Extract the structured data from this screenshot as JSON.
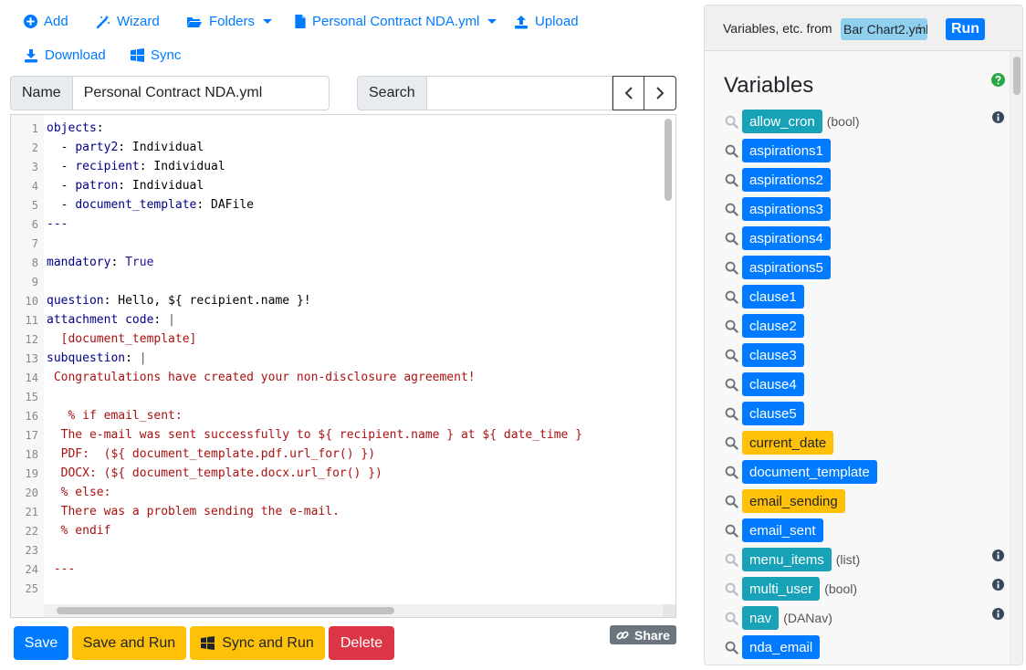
{
  "toolbar": {
    "add": "Add",
    "wizard": "Wizard",
    "folders": "Folders",
    "file_dropdown": "Personal Contract NDA.yml",
    "upload": "Upload",
    "download": "Download",
    "sync": "Sync"
  },
  "name_field": {
    "label": "Name",
    "value": "Personal Contract NDA.yml"
  },
  "search_field": {
    "label": "Search",
    "value": ""
  },
  "editor": {
    "lines": [
      {
        "n": "1",
        "parts": [
          {
            "c": "key",
            "t": "objects"
          },
          {
            "c": "val",
            "t": ":"
          }
        ]
      },
      {
        "n": "2",
        "parts": [
          {
            "c": "val",
            "t": "  - "
          },
          {
            "c": "key",
            "t": "party2"
          },
          {
            "c": "val",
            "t": ": Individual"
          }
        ]
      },
      {
        "n": "3",
        "parts": [
          {
            "c": "val",
            "t": "  - "
          },
          {
            "c": "key",
            "t": "recipient"
          },
          {
            "c": "val",
            "t": ": Individual"
          }
        ]
      },
      {
        "n": "4",
        "parts": [
          {
            "c": "val",
            "t": "  - "
          },
          {
            "c": "key",
            "t": "patron"
          },
          {
            "c": "val",
            "t": ": Individual"
          }
        ]
      },
      {
        "n": "5",
        "parts": [
          {
            "c": "val",
            "t": "  - "
          },
          {
            "c": "key",
            "t": "document_template"
          },
          {
            "c": "val",
            "t": ": DAFile"
          }
        ]
      },
      {
        "n": "6",
        "parts": [
          {
            "c": "key",
            "t": "---"
          }
        ]
      },
      {
        "n": "7",
        "parts": []
      },
      {
        "n": "8",
        "parts": [
          {
            "c": "key",
            "t": "mandatory"
          },
          {
            "c": "val",
            "t": ": "
          },
          {
            "c": "atom",
            "t": "True"
          }
        ]
      },
      {
        "n": "9",
        "parts": []
      },
      {
        "n": "10",
        "parts": [
          {
            "c": "key",
            "t": "question"
          },
          {
            "c": "val",
            "t": ": Hello, ${ recipient.name }!"
          }
        ]
      },
      {
        "n": "11",
        "parts": [
          {
            "c": "key",
            "t": "attachment code"
          },
          {
            "c": "val",
            "t": ": "
          },
          {
            "c": "bar",
            "t": "|"
          }
        ]
      },
      {
        "n": "12",
        "parts": [
          {
            "c": "str",
            "t": "  [document_template]"
          }
        ]
      },
      {
        "n": "13",
        "parts": [
          {
            "c": "key",
            "t": "subquestion"
          },
          {
            "c": "val",
            "t": ": "
          },
          {
            "c": "bar",
            "t": "|"
          }
        ]
      },
      {
        "n": "14",
        "parts": [
          {
            "c": "str",
            "t": " Congratulations have created your non-disclosure agreement!"
          }
        ]
      },
      {
        "n": "15",
        "parts": []
      },
      {
        "n": "16",
        "parts": [
          {
            "c": "str",
            "t": "   % if email_sent:"
          }
        ]
      },
      {
        "n": "17",
        "parts": [
          {
            "c": "str",
            "t": "  The e-mail was sent successfully to ${ recipient.name } at ${ date_time }"
          }
        ]
      },
      {
        "n": "18",
        "parts": [
          {
            "c": "str",
            "t": "  PDF:  (${ document_template.pdf.url_for() })"
          }
        ]
      },
      {
        "n": "19",
        "parts": [
          {
            "c": "str",
            "t": "  DOCX: (${ document_template.docx.url_for() })"
          }
        ]
      },
      {
        "n": "20",
        "parts": [
          {
            "c": "str",
            "t": "  % else:"
          }
        ]
      },
      {
        "n": "21",
        "parts": [
          {
            "c": "str",
            "t": "  There was a problem sending the e-mail."
          }
        ]
      },
      {
        "n": "22",
        "parts": [
          {
            "c": "str",
            "t": "  % endif"
          }
        ]
      },
      {
        "n": "23",
        "parts": []
      },
      {
        "n": "24",
        "parts": [
          {
            "c": "str",
            "t": " ---"
          }
        ]
      },
      {
        "n": "25",
        "parts": []
      }
    ]
  },
  "buttons": {
    "save": "Save",
    "save_and_run": "Save and Run",
    "sync_and_run": "Sync and Run",
    "delete": "Delete",
    "share": "Share"
  },
  "panel": {
    "header_text": "Variables, etc. from",
    "selected_file": "Bar Chart2.yml",
    "run": "Run",
    "title": "Variables",
    "variables": [
      {
        "name": "allow_cron",
        "style": "info",
        "type": "(bool)",
        "info": true
      },
      {
        "name": "aspirations1",
        "style": "primary",
        "type": "",
        "info": false
      },
      {
        "name": "aspirations2",
        "style": "primary",
        "type": "",
        "info": false
      },
      {
        "name": "aspirations3",
        "style": "primary",
        "type": "",
        "info": false
      },
      {
        "name": "aspirations4",
        "style": "primary",
        "type": "",
        "info": false
      },
      {
        "name": "aspirations5",
        "style": "primary",
        "type": "",
        "info": false
      },
      {
        "name": "clause1",
        "style": "primary",
        "type": "",
        "info": false
      },
      {
        "name": "clause2",
        "style": "primary",
        "type": "",
        "info": false
      },
      {
        "name": "clause3",
        "style": "primary",
        "type": "",
        "info": false
      },
      {
        "name": "clause4",
        "style": "primary",
        "type": "",
        "info": false
      },
      {
        "name": "clause5",
        "style": "primary",
        "type": "",
        "info": false
      },
      {
        "name": "current_date",
        "style": "warning",
        "type": "",
        "info": false
      },
      {
        "name": "document_template",
        "style": "primary",
        "type": "",
        "info": false
      },
      {
        "name": "email_sending",
        "style": "warning",
        "type": "",
        "info": false
      },
      {
        "name": "email_sent",
        "style": "primary",
        "type": "",
        "info": false
      },
      {
        "name": "menu_items",
        "style": "info",
        "type": "(list)",
        "info": true
      },
      {
        "name": "multi_user",
        "style": "info",
        "type": "(bool)",
        "info": true
      },
      {
        "name": "nav",
        "style": "info",
        "type": "(DANav)",
        "info": true
      },
      {
        "name": "nda_email",
        "style": "primary",
        "type": "",
        "info": false
      }
    ]
  }
}
